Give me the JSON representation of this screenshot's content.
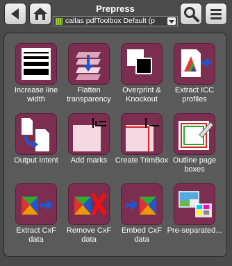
{
  "header": {
    "title": "Prepress",
    "profile": "callas pdfToolbox Default (p",
    "back_icon": "back-arrow-icon",
    "home_icon": "home-icon",
    "search_icon": "search-icon",
    "menu_icon": "menu-icon"
  },
  "tiles": [
    {
      "label": "Increase line width",
      "icon": "line-width-icon"
    },
    {
      "label": "Flatten transparency",
      "icon": "flatten-icon"
    },
    {
      "label": "Overprint & Knockout",
      "icon": "overprint-icon"
    },
    {
      "label": "Extract ICC profiles",
      "icon": "icc-extract-icon"
    },
    {
      "label": "Output Intent",
      "icon": "output-intent-icon"
    },
    {
      "label": "Add marks",
      "icon": "marks-icon"
    },
    {
      "label": "Create TrimBox",
      "icon": "trimbox-icon"
    },
    {
      "label": "Outline page boxes",
      "icon": "outline-boxes-icon"
    },
    {
      "label": "Extract CxF data",
      "icon": "cxf-extract-icon"
    },
    {
      "label": "Remove CxF data",
      "icon": "cxf-remove-icon"
    },
    {
      "label": "Embed CxF data",
      "icon": "cxf-embed-icon"
    },
    {
      "label": "Pre-separated...",
      "icon": "preseparated-icon"
    }
  ],
  "colors": {
    "tile": "#7b2e50",
    "panel": "#5a5a5a",
    "background": "#4a4a4a"
  }
}
